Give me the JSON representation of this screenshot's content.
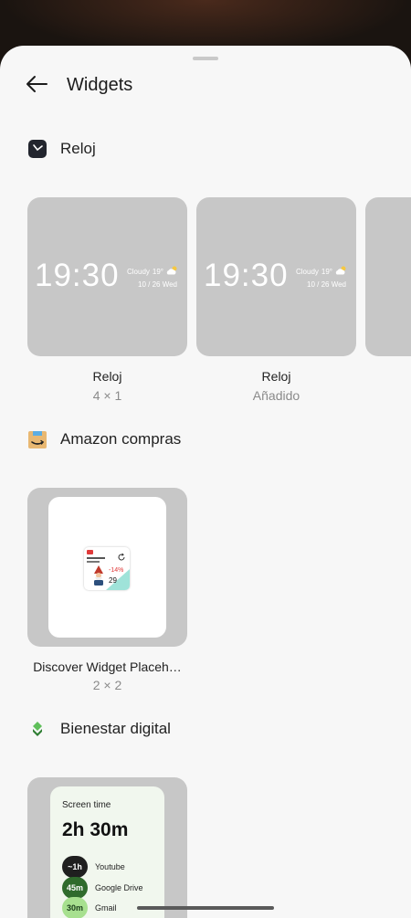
{
  "header": {
    "title": "Widgets",
    "back_icon": "back-arrow-icon"
  },
  "sections": [
    {
      "app_name": "Reloj",
      "icon": "clock-app-icon",
      "widgets": [
        {
          "preview": {
            "time": "19:30",
            "weather": "Cloudy",
            "temp": "19°",
            "date": "10 / 26  Wed"
          },
          "label": "Reloj",
          "sub": "4 × 1"
        },
        {
          "preview": {
            "time": "19:30",
            "weather": "Cloudy",
            "temp": "19°",
            "date": "10 / 26  Wed"
          },
          "label": "Reloj",
          "sub": "Añadido"
        }
      ]
    },
    {
      "app_name": "Amazon compras",
      "icon": "amazon-app-icon",
      "widgets": [
        {
          "label": "Discover Widget Placeh…",
          "sub": "2 × 2",
          "preview": {
            "discount": "-14%",
            "price": "29"
          }
        }
      ]
    },
    {
      "app_name": "Bienestar digital",
      "icon": "digital-wellbeing-icon",
      "widgets": [
        {
          "preview": {
            "title": "Screen time",
            "total": "2h 30m",
            "apps": [
              {
                "time": "~1h",
                "name": "Youtube",
                "color": "#1f1f1f"
              },
              {
                "time": "45m",
                "name": "Google Drive",
                "color": "#2f6b2c"
              },
              {
                "time": "30m",
                "name": "Gmail",
                "color": "#a7e08f"
              }
            ]
          }
        }
      ]
    }
  ],
  "colors": {
    "sheet_bg": "#f7f7f7",
    "card_bg": "#c7c7c7",
    "accent_green": "#2f6b2c"
  }
}
